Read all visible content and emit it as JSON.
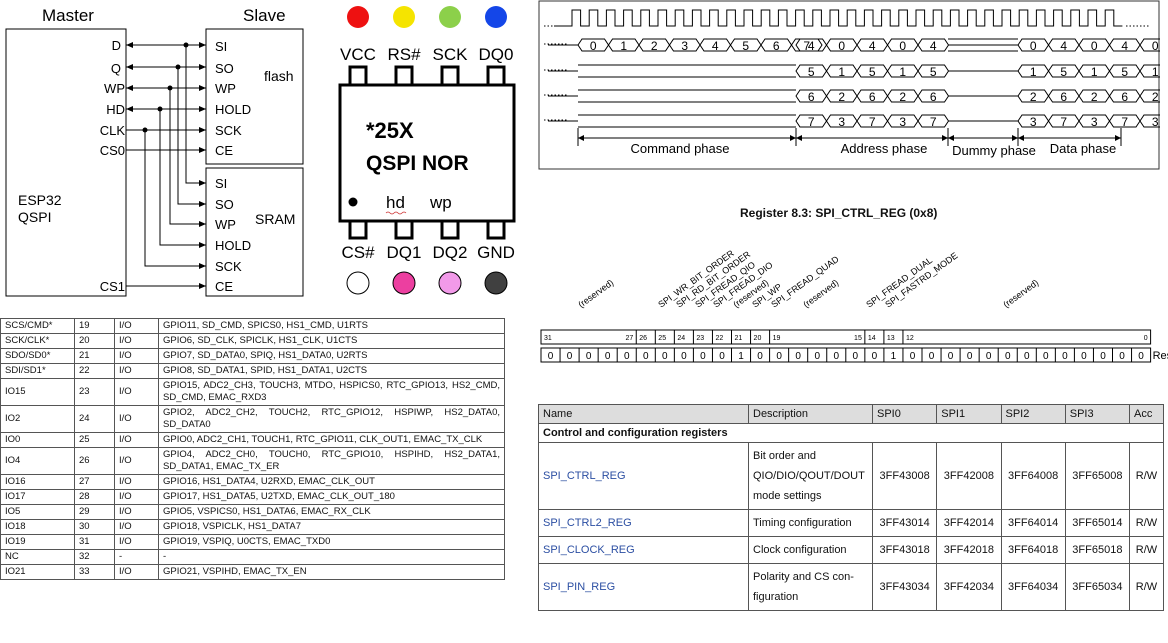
{
  "diagram": {
    "master_label": "Master",
    "slave_label": "Slave",
    "esp_line1": "ESP32",
    "esp_line2": "QSPI",
    "flash_label": "flash",
    "sram_label": "SRAM",
    "master_pins": [
      "D",
      "Q",
      "WP",
      "HD",
      "CLK",
      "CS0",
      "CS1"
    ],
    "flash_pins": [
      "SI",
      "SO",
      "WP",
      "HOLD",
      "SCK",
      "CE"
    ],
    "sram_pins": [
      "SI",
      "SO",
      "WP",
      "HOLD",
      "SCK",
      "CE"
    ]
  },
  "chip": {
    "top_pins": [
      "VCC",
      "RS#",
      "SCK",
      "DQ0"
    ],
    "bottom_pins": [
      "CS#",
      "DQ1",
      "DQ2",
      "GND"
    ],
    "line1": "*25X",
    "line2": "QSPI NOR",
    "hd": "hd",
    "wp": "wp",
    "top_colors": [
      "#ee1111",
      "#f5e400",
      "#8cd04a",
      "#1446e8"
    ],
    "bottom_colors": [
      "#ffffff",
      "#ec3fa0",
      "#f29ae9",
      "#404040"
    ]
  },
  "timing": {
    "line0": [
      "0",
      "1",
      "2",
      "3",
      "4",
      "5",
      "6",
      "7",
      "4",
      "0",
      "4",
      "0",
      "4",
      "0",
      "4",
      "0",
      "4",
      "0"
    ],
    "line1": [
      "5",
      "1",
      "5",
      "1",
      "5",
      "1",
      "5",
      "1",
      "5",
      "1"
    ],
    "line2": [
      "6",
      "2",
      "6",
      "2",
      "6",
      "2",
      "6",
      "2",
      "6",
      "2"
    ],
    "line3": [
      "7",
      "3",
      "7",
      "3",
      "7",
      "3",
      "7",
      "3",
      "7",
      "3"
    ],
    "phases": [
      "Command phase",
      "Address phase",
      "Dummy phase",
      "Data phase"
    ]
  },
  "pin_table": [
    [
      "SCS/CMD*",
      "19",
      "I/O",
      "GPIO11, SD_CMD, SPICS0, HS1_CMD, U1RTS"
    ],
    [
      "SCK/CLK*",
      "20",
      "I/O",
      "GPIO6, SD_CLK, SPICLK, HS1_CLK, U1CTS"
    ],
    [
      "SDO/SD0*",
      "21",
      "I/O",
      "GPIO7, SD_DATA0, SPIQ, HS1_DATA0, U2RTS"
    ],
    [
      "SDI/SD1*",
      "22",
      "I/O",
      "GPIO8, SD_DATA1, SPID, HS1_DATA1, U2CTS"
    ],
    [
      "IO15",
      "23",
      "I/O",
      "GPIO15, ADC2_CH3, TOUCH3, MTDO, HSPICS0, RTC_GPIO13, HS2_CMD, SD_CMD, EMAC_RXD3"
    ],
    [
      "IO2",
      "24",
      "I/O",
      "GPIO2, ADC2_CH2, TOUCH2, RTC_GPIO12, HSPIWP, HS2_DATA0, SD_DATA0"
    ],
    [
      "IO0",
      "25",
      "I/O",
      "GPIO0, ADC2_CH1, TOUCH1, RTC_GPIO11, CLK_OUT1, EMAC_TX_CLK"
    ],
    [
      "IO4",
      "26",
      "I/O",
      "GPIO4, ADC2_CH0, TOUCH0, RTC_GPIO10, HSPIHD, HS2_DATA1, SD_DATA1, EMAC_TX_ER"
    ],
    [
      "IO16",
      "27",
      "I/O",
      "GPIO16, HS1_DATA4, U2RXD, EMAC_CLK_OUT"
    ],
    [
      "IO17",
      "28",
      "I/O",
      "GPIO17, HS1_DATA5, U2TXD, EMAC_CLK_OUT_180"
    ],
    [
      "IO5",
      "29",
      "I/O",
      "GPIO5, VSPICS0, HS1_DATA6, EMAC_RX_CLK"
    ],
    [
      "IO18",
      "30",
      "I/O",
      "GPIO18, VSPICLK, HS1_DATA7"
    ],
    [
      "IO19",
      "31",
      "I/O",
      "GPIO19, VSPIQ, U0CTS, EMAC_TXD0"
    ],
    [
      "NC",
      "32",
      "-",
      "-"
    ],
    [
      "IO21",
      "33",
      "I/O",
      "GPIO21, VSPIHD, EMAC_TX_EN"
    ]
  ],
  "register": {
    "title": "Register 8.3: SPI_CTRL_REG (0x8)",
    "fields": [
      "(reserved)",
      "SPI_WR_BIT_ORDER",
      "SPI_RD_BIT_ORDER",
      "SPI_FREAD_QIO",
      "SPI_FREAD_DIO",
      "(reserved)",
      "SPI_WP",
      "SPI_FREAD_QUAD",
      "(reserved)",
      "SPI_FREAD_DUAL",
      "SPI_FASTRD_MODE",
      "(reserved)"
    ],
    "bit_labels": [
      "31",
      "27",
      "26",
      "25",
      "24",
      "23",
      "22",
      "21",
      "20",
      "19",
      "15",
      "14",
      "13",
      "12",
      "0"
    ],
    "reset_values": [
      "0",
      "0",
      "0",
      "0",
      "0",
      "0",
      "0",
      "0",
      "0",
      "0",
      "1",
      "0",
      "0",
      "0",
      "0",
      "0",
      "0",
      "0",
      "1",
      "0",
      "0",
      "0",
      "0",
      "0",
      "0",
      "0",
      "0",
      "0",
      "0",
      "0",
      "0",
      "0"
    ],
    "reset_label": "Reset"
  },
  "reg_table": {
    "headers": [
      "Name",
      "Description",
      "SPI0",
      "SPI1",
      "SPI2",
      "SPI3",
      "Acc"
    ],
    "section": "Control and configuration registers",
    "rows": [
      {
        "name": "SPI_CTRL_REG",
        "desc": [
          "Bit order and",
          "QIO/DIO/QOUT/DOUT",
          "mode settings"
        ],
        "v": [
          "3FF43008",
          "3FF42008",
          "3FF64008",
          "3FF65008",
          "R/W"
        ]
      },
      {
        "name": "SPI_CTRL2_REG",
        "desc": [
          "Timing configuration"
        ],
        "v": [
          "3FF43014",
          "3FF42014",
          "3FF64014",
          "3FF65014",
          "R/W"
        ]
      },
      {
        "name": "SPI_CLOCK_REG",
        "desc": [
          "Clock configuration"
        ],
        "v": [
          "3FF43018",
          "3FF42018",
          "3FF64018",
          "3FF65018",
          "R/W"
        ]
      },
      {
        "name": "SPI_PIN_REG",
        "desc": [
          "Polarity and CS con-",
          "figuration"
        ],
        "v": [
          "3FF43034",
          "3FF42034",
          "3FF64034",
          "3FF65034",
          "R/W"
        ]
      }
    ]
  }
}
